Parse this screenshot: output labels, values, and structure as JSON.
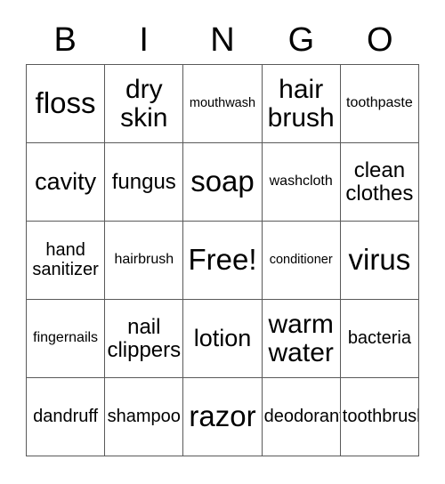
{
  "card": {
    "title": "BINGO",
    "header_letters": [
      "B",
      "I",
      "N",
      "G",
      "O"
    ],
    "grid_size": "5x5",
    "free_space": "Free!",
    "colors": {
      "background": "#ffffff",
      "text": "#000000",
      "grid_line": "#5a5a5a"
    },
    "rows": [
      [
        {
          "text": "floss",
          "size": "fs-xxl"
        },
        {
          "text": "dry\nskin",
          "size": "fs-xl"
        },
        {
          "text": "mouthwash",
          "size": "fs-xxs"
        },
        {
          "text": "hair\nbrush",
          "size": "fs-xl"
        },
        {
          "text": "toothpaste",
          "size": "fs-xs"
        }
      ],
      [
        {
          "text": "cavity",
          "size": "fs-lg"
        },
        {
          "text": "fungus",
          "size": "fs-md"
        },
        {
          "text": "soap",
          "size": "fs-xxl"
        },
        {
          "text": "washcloth",
          "size": "fs-xs"
        },
        {
          "text": "clean\nclothes",
          "size": "fs-md"
        }
      ],
      [
        {
          "text": "hand\nsanitizer",
          "size": "fs-sm"
        },
        {
          "text": "hairbrush",
          "size": "fs-xs"
        },
        {
          "text": "Free!",
          "size": "fs-xxl"
        },
        {
          "text": "conditioner",
          "size": "fs-xxs"
        },
        {
          "text": "virus",
          "size": "fs-xxl"
        }
      ],
      [
        {
          "text": "fingernails",
          "size": "fs-xs"
        },
        {
          "text": "nail\nclippers",
          "size": "fs-md"
        },
        {
          "text": "lotion",
          "size": "fs-lg"
        },
        {
          "text": "warm\nwater",
          "size": "fs-xl"
        },
        {
          "text": "bacteria",
          "size": "fs-sm"
        }
      ],
      [
        {
          "text": "dandruff",
          "size": "fs-sm"
        },
        {
          "text": "shampoo",
          "size": "fs-sm"
        },
        {
          "text": "razor",
          "size": "fs-xxl"
        },
        {
          "text": "deodorant",
          "size": "fs-sm"
        },
        {
          "text": "toothbrush",
          "size": "fs-sm"
        }
      ]
    ]
  }
}
